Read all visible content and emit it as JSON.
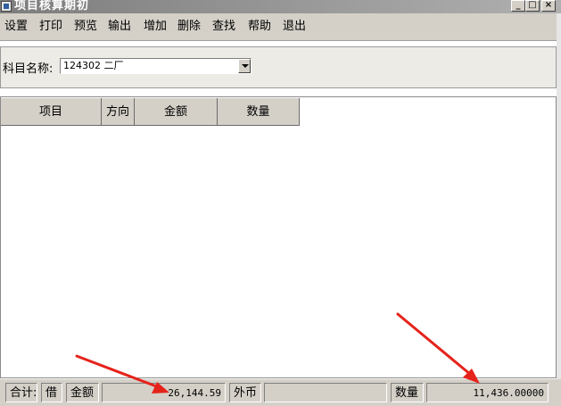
{
  "window": {
    "title": "项目核算期初"
  },
  "window_controls": {
    "minimize": "_",
    "maximize": "□",
    "close": "×"
  },
  "menu": [
    {
      "label": "设置"
    },
    {
      "label": "打印"
    },
    {
      "label": "预览"
    },
    {
      "label": "输出"
    },
    {
      "label": "增加"
    },
    {
      "label": "删除"
    },
    {
      "label": "查找"
    },
    {
      "label": "帮助"
    },
    {
      "label": "退出"
    }
  ],
  "form": {
    "subject_label": "科目名称:",
    "subject_value": "124302 二厂"
  },
  "table": {
    "columns": [
      "项目",
      "方向",
      "金额",
      "数量"
    ],
    "rows": []
  },
  "status": {
    "total_label": "合计:",
    "direction": "借",
    "amount_label": "金额",
    "amount_value": "26,144.59",
    "foreign_label": "外币",
    "foreign_value": "",
    "qty_label": "数量",
    "qty_value": "11,436.00000"
  },
  "annotations": {
    "arrow_color": "#e5231b"
  },
  "colors": {
    "panel": "#d4d0c8",
    "titlebar": "#8a8a8a"
  }
}
